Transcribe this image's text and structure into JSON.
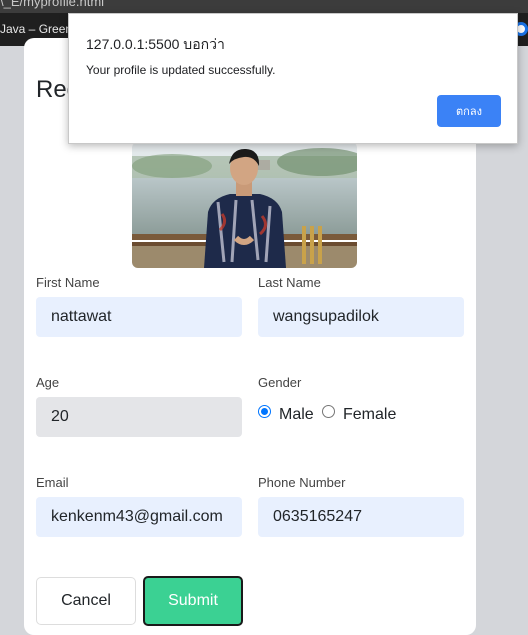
{
  "browser": {
    "url_fragment": "\\_E/myprofile.html",
    "bookmark": "Java – Green."
  },
  "form": {
    "heading": "Reg",
    "first_name": {
      "label": "First Name",
      "value": "nattawat"
    },
    "last_name": {
      "label": "Last Name",
      "value": "wangsupadilok"
    },
    "age": {
      "label": "Age",
      "value": "20"
    },
    "gender": {
      "label": "Gender",
      "options": [
        "Male",
        "Female"
      ],
      "selected": "Male"
    },
    "email": {
      "label": "Email",
      "value": "kenkenm43@gmail.com"
    },
    "phone": {
      "label": "Phone Number",
      "value": "0635165247"
    },
    "cancel_label": "Cancel",
    "submit_label": "Submit"
  },
  "dialog": {
    "title": "127.0.0.1:5500 บอกว่า",
    "message": "Your profile is updated successfully.",
    "ok_label": "ตกลง"
  },
  "colors": {
    "submit": "#3bd193",
    "dialog_ok": "#3b82f6",
    "input_bg": "#e8f0fe"
  }
}
